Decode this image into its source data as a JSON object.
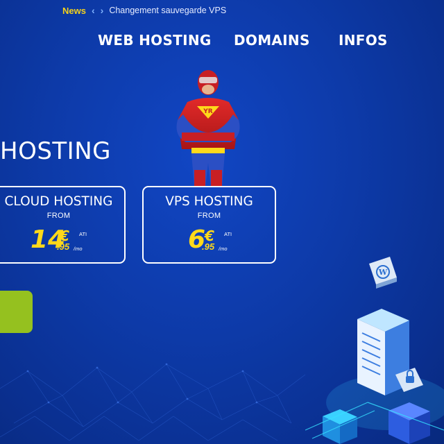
{
  "news": {
    "label": "News",
    "prev_arrow": "‹",
    "next_arrow": "›",
    "headline": "Changement sauvegarde VPS"
  },
  "nav": {
    "items": [
      "WEB HOSTING",
      "DOMAINS",
      "INFOS"
    ]
  },
  "hero": {
    "title": "HOSTING"
  },
  "cards": [
    {
      "title": "CLOUD HOSTING",
      "from": "FROM",
      "price_int": "14",
      "currency": "€",
      "cents": ".95",
      "tax": "ATI",
      "period": "/mo"
    },
    {
      "title": "VPS HOSTING",
      "from": "FROM",
      "price_int": "6",
      "currency": "€",
      "cents": ".95",
      "tax": "ATI",
      "period": "/mo"
    }
  ],
  "mascot": {
    "badge": "YR"
  },
  "icons": {
    "mascot": "superhero-mascot-icon",
    "wordpress": "wordpress-icon",
    "servers": "server-stack-icon"
  },
  "colors": {
    "background": "#0d3aa8",
    "accent_yellow": "#ffd91a",
    "news_yellow": "#f5d21b",
    "button_green": "#95c11f"
  }
}
